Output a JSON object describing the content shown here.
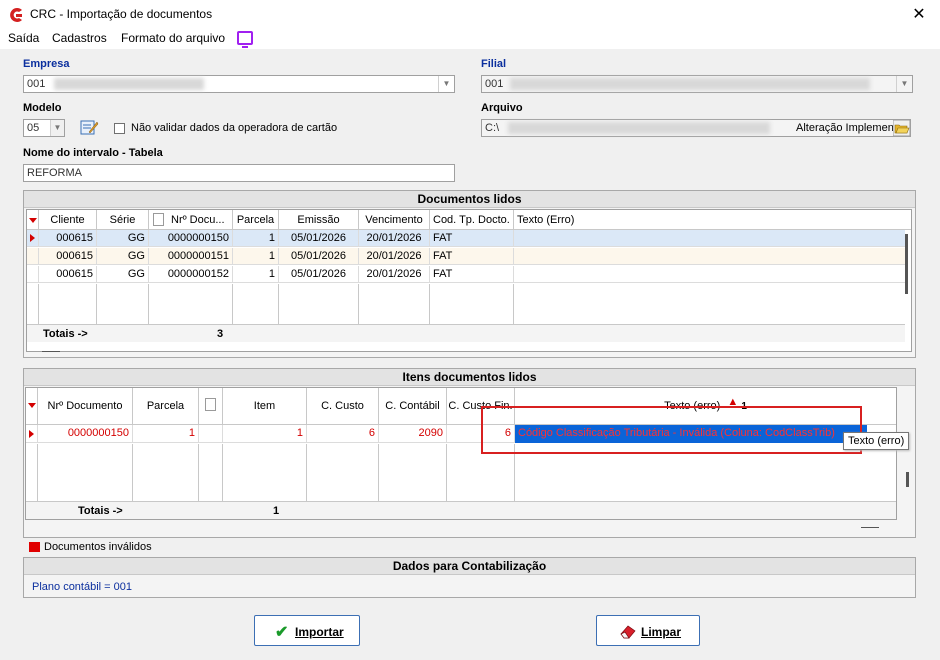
{
  "window": {
    "title": "CRC - Importação de documentos",
    "close_label": "✕"
  },
  "menu": {
    "items": [
      "Saída",
      "Cadastros",
      "Formato do arquivo"
    ]
  },
  "form": {
    "empresa_label": "Empresa",
    "empresa_value": "001",
    "filial_label": "Filial",
    "filial_value": "001",
    "modelo_label": "Modelo",
    "modelo_value": "05",
    "checkbox_label": "Não validar dados da operadora de cartão",
    "arquivo_label": "Arquivo",
    "arquivo_prefix": "C:\\",
    "arquivo_suffix": "Alteração Implemen",
    "intervalo_label": "Nome do intervalo - Tabela",
    "intervalo_value": "REFORMA"
  },
  "docs": {
    "title": "Documentos lidos",
    "columns": [
      "Cliente",
      "Série",
      "Nrº Docu...",
      "Parcela",
      "Emissão",
      "Vencimento",
      "Cod. Tp. Docto.",
      "Texto (Erro)"
    ],
    "rows": [
      [
        "000615",
        "GG",
        "0000000150",
        "1",
        "05/01/2026",
        "20/01/2026",
        "FAT",
        ""
      ],
      [
        "000615",
        "GG",
        "0000000151",
        "1",
        "05/01/2026",
        "20/01/2026",
        "FAT",
        ""
      ],
      [
        "000615",
        "GG",
        "0000000152",
        "1",
        "05/01/2026",
        "20/01/2026",
        "FAT",
        ""
      ]
    ],
    "totals_label": "Totais ->",
    "totals_value": "3"
  },
  "items": {
    "title": "Itens documentos lidos",
    "columns": [
      "Nrº Documento",
      "Parcela",
      "",
      "Item",
      "C. Custo",
      "C. Contábil",
      "C. Custo Fin.",
      "Texto (erro)"
    ],
    "sort_marker": "1",
    "row": [
      "0000000150",
      "1",
      "",
      "1",
      "6",
      "2090",
      "6",
      "Código Classificação Tributária - Inválida (Coluna: CodClassTrib)"
    ],
    "totals_label": "Totais ->",
    "totals_value": "1",
    "tooltip": "Texto (erro)"
  },
  "legend": {
    "invalid_label": "Documentos inválidos",
    "invalid_color": "#e00000"
  },
  "contab": {
    "title": "Dados para Contabilização",
    "plano": "Plano contábil = 001"
  },
  "buttons": {
    "import_label": "Importar",
    "clear_label": "Limpar"
  },
  "colors": {
    "accent_red": "#d40000",
    "highlight_blue": "#0a64d8",
    "header_blue": "#0b2f9e"
  }
}
